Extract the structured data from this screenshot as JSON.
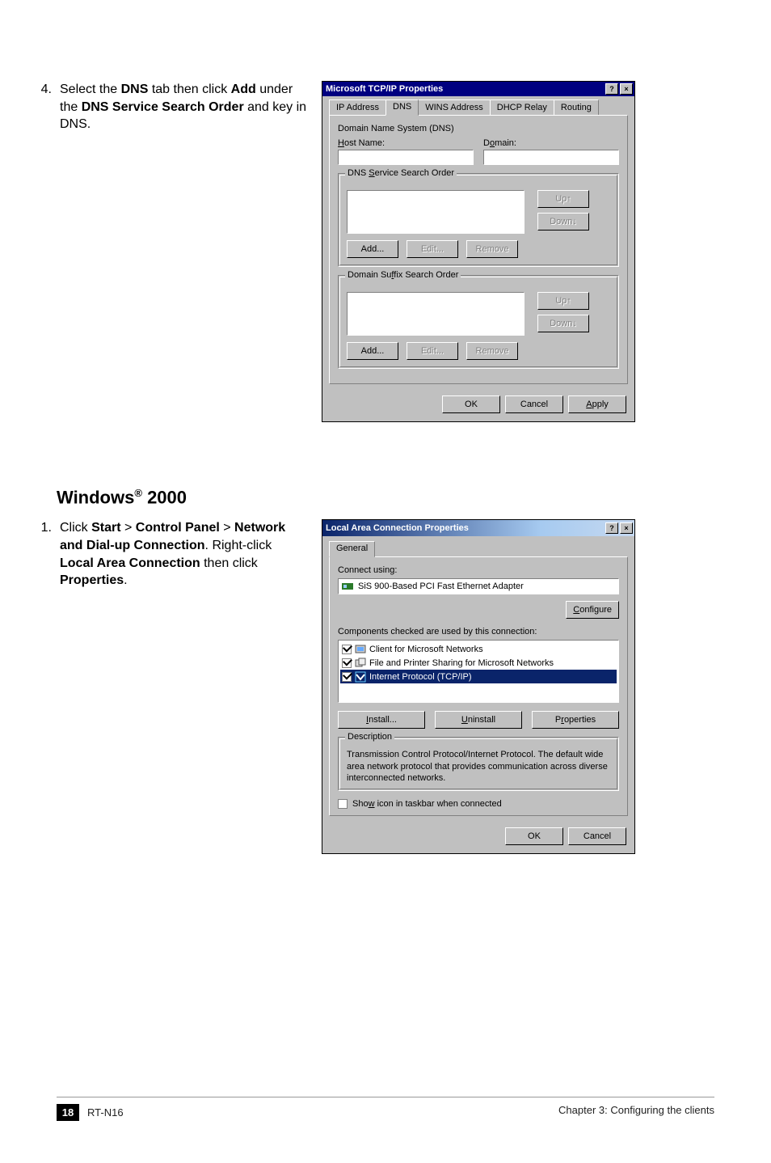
{
  "step4": {
    "num": "4.",
    "text_a": "Select the ",
    "bold_a": "DNS",
    "text_b": " tab then click ",
    "bold_b": "Add",
    "text_c": " under the ",
    "bold_c": "DNS Service Search Order",
    "text_d": " and key in DNS."
  },
  "dlg1": {
    "title": "Microsoft TCP/IP Properties",
    "help_glyph": "?",
    "close_glyph": "×",
    "tabs": {
      "ip_html": "IP Address",
      "dns": "DNS",
      "wins_html": "WINS Address",
      "dhcp": "DHCP Relay",
      "routing": "Routing"
    },
    "dns_panel": {
      "section_label": "Domain Name System (DNS)",
      "host_html": "Host Name:",
      "domain_html": "Domain:",
      "service_title_html": "DNS Service Search Order",
      "suffix_title_html": "Domain Suffix Search Order",
      "btn_up": "Up↑",
      "btn_down": "Down↓",
      "btn_add": "Add...",
      "btn_edit": "Edit...",
      "btn_remove": "Remove"
    },
    "ok": "OK",
    "cancel": "Cancel",
    "apply_html": "Apply"
  },
  "section_heading_a": "Windows",
  "section_heading_b": " 2000",
  "step1": {
    "num": "1.",
    "t1": "Click ",
    "b1": "Start",
    "t2": " > ",
    "b2": "Control Panel",
    "t3": " > ",
    "b3": "Network and Dial-up Connection",
    "t4": ". Right-click ",
    "b4": "Local Area Connection",
    "t5": " then click ",
    "b5": "Properties",
    "t6": "."
  },
  "dlg2": {
    "title": "Local Area Connection Properties",
    "help_glyph": "?",
    "close_glyph": "×",
    "tab_general": "General",
    "connect_using": "Connect using:",
    "adapter": "SiS 900-Based PCI Fast Ethernet Adapter",
    "configure_html": "Configure",
    "components_label": "Components checked are used by this connection:",
    "items": {
      "client": "Client for Microsoft Networks",
      "fps": "File and Printer Sharing for Microsoft Networks",
      "tcpip": "Internet Protocol (TCP/IP)"
    },
    "install_html": "Install...",
    "uninstall_html": "Uninstall",
    "properties_html": "Properties",
    "desc_title": "Description",
    "desc_text": "Transmission Control Protocol/Internet Protocol. The default wide area network protocol that provides communication across diverse interconnected networks.",
    "show_html": "Show icon in taskbar when connected",
    "ok": "OK",
    "cancel": "Cancel"
  },
  "footer": {
    "page": "18",
    "model": "RT-N16",
    "chapter": "Chapter 3: Configuring the clients"
  }
}
